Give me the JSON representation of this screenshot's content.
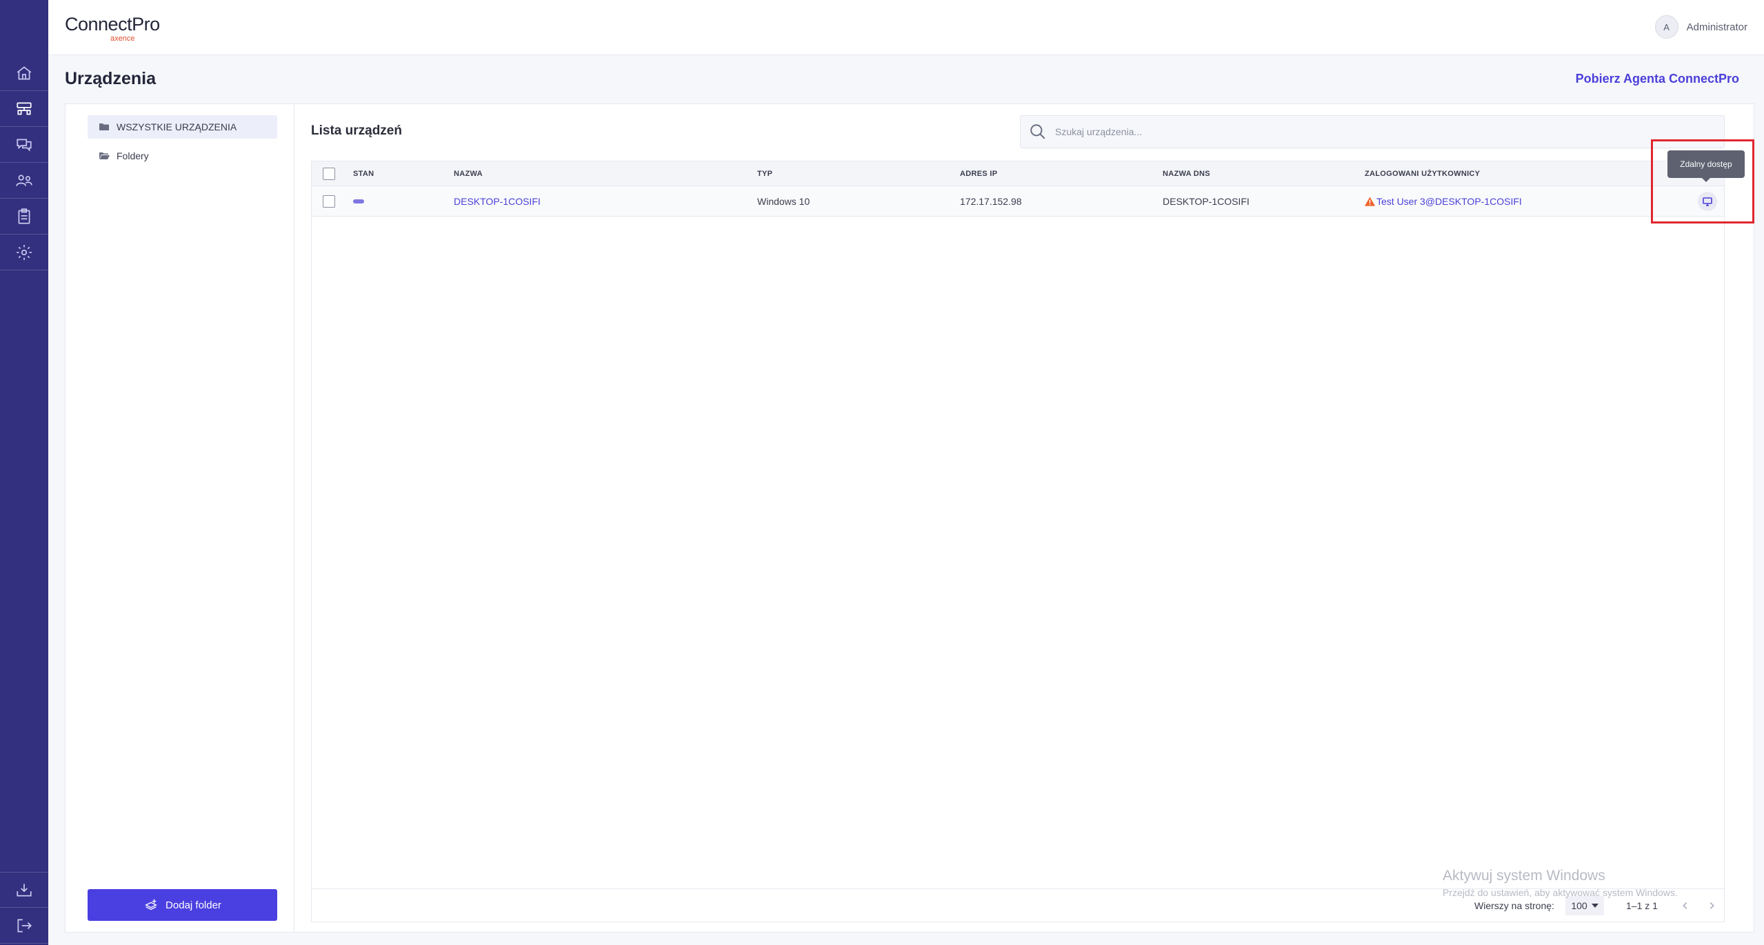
{
  "app": {
    "logo_main": "ConnectPro",
    "logo_sub": "axence"
  },
  "user": {
    "initial": "A",
    "name": "Administrator"
  },
  "nav": {
    "items": [
      "home-icon",
      "devices-icon",
      "chat-icon",
      "users-icon",
      "clipboard-icon",
      "gear-icon"
    ],
    "bottom": [
      "download-icon",
      "logout-icon"
    ]
  },
  "page": {
    "title": "Urządzenia",
    "agent_link": "Pobierz Agenta ConnectPro"
  },
  "tree": {
    "all_devices": "WSZYSTKIE URZĄDZENIA",
    "folders": "Foldery",
    "add_folder": "Dodaj folder"
  },
  "list": {
    "title": "Lista urządzeń",
    "search_placeholder": "Szukaj urządzenia...",
    "columns": [
      "STAN",
      "NAZWA",
      "TYP",
      "ADRES IP",
      "NAZWA DNS",
      "ZALOGOWANI UŻYTKOWNICY"
    ],
    "rows": [
      {
        "name": "DESKTOP-1COSIFI",
        "type": "Windows 10",
        "ip": "172.17.152.98",
        "dns": "DESKTOP-1COSIFI",
        "user": "Test User 3@DESKTOP-1COSIFI"
      }
    ],
    "tooltip": "Zdalny dostęp",
    "footer": {
      "rows_per_page_label": "Wierszy na stronę:",
      "rows_per_page": "100",
      "range": "1–1 z 1"
    }
  },
  "watermark": {
    "title": "Aktywuj system Windows",
    "subtitle": "Przejdź do ustawień, aby aktywować system Windows."
  },
  "colors": {
    "rail": "#33307f",
    "accent": "#4a3fd8",
    "warning": "#f0622a",
    "highlight": "#e0262e"
  }
}
